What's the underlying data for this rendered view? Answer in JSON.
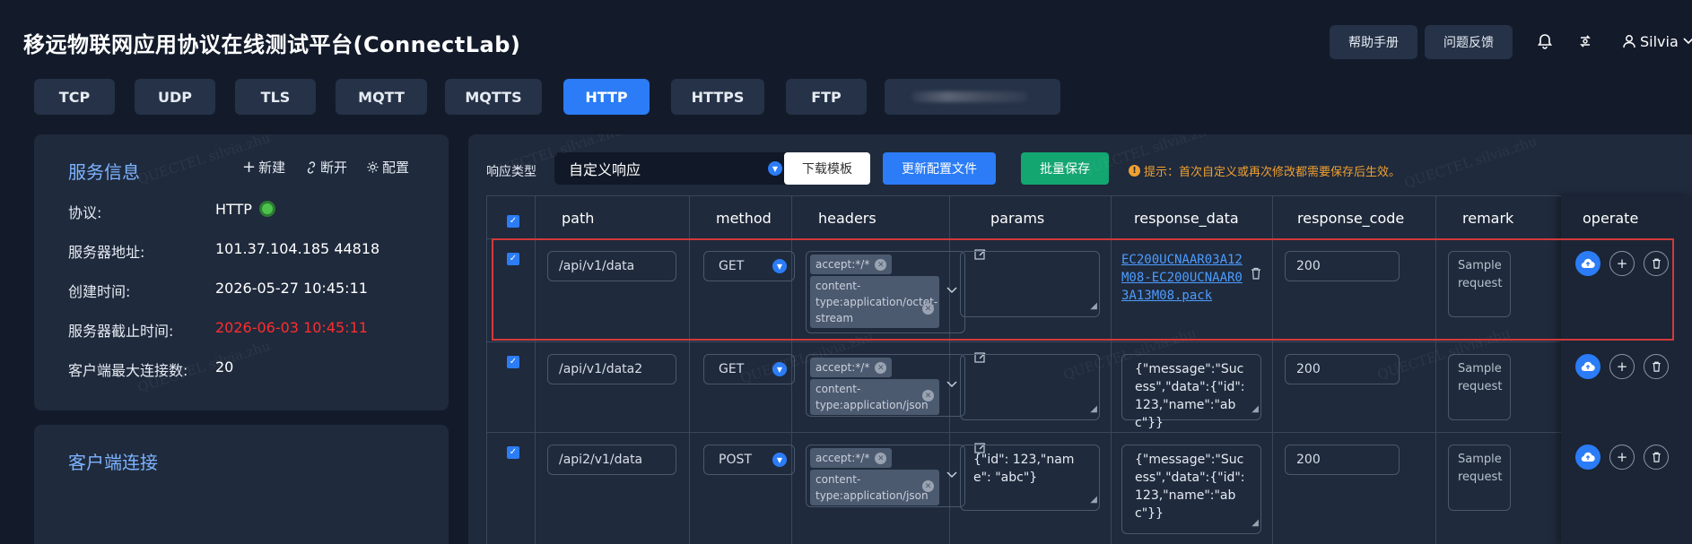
{
  "header": {
    "title": "移远物联网应用协议在线测试平台(ConnectLab)",
    "help_button": "帮助手册",
    "feedback_button": "问题反馈",
    "user_name": "Silvia"
  },
  "protocol_tabs": [
    "TCP",
    "UDP",
    "TLS",
    "MQTT",
    "MQTTS",
    "HTTP",
    "HTTPS",
    "FTP"
  ],
  "active_tab": "HTTP",
  "service_info": {
    "title": "服务信息",
    "actions": {
      "new": "新建",
      "disconnect": "断开",
      "config": "配置"
    },
    "rows": [
      {
        "label": "协议:",
        "value": "HTTP"
      },
      {
        "label": "服务器地址:",
        "value": "101.37.104.185 44818"
      },
      {
        "label": "创建时间:",
        "value": "2026-05-27 10:45:11"
      },
      {
        "label": "服务器截止时间:",
        "value": "2026-06-03 10:45:11"
      },
      {
        "label": "客户端最大连接数:",
        "value": "20"
      }
    ]
  },
  "client_panel": {
    "title": "客户端连接"
  },
  "toolbar": {
    "response_type_label": "响应类型",
    "response_type_value": "自定义响应",
    "download_template": "下载模板",
    "update_config": "更新配置文件",
    "batch_save": "批量保存",
    "tip": "提示：首次自定义或再次修改都需要保存后生效。"
  },
  "table": {
    "columns": [
      "path",
      "method",
      "headers",
      "params",
      "response_data",
      "response_code",
      "remark",
      "operate"
    ],
    "rows": [
      {
        "path": "/api/v1/data",
        "method": "GET",
        "headers": [
          "accept:*/*",
          "content-type:application/octet-stream"
        ],
        "params": "",
        "response_data": "EC200UCNAAR03A12M08-EC200UCNAAR03A13M08.pack",
        "response_code": "200",
        "remark": "Sample request"
      },
      {
        "path": "/api/v1/data2",
        "method": "GET",
        "headers": [
          "accept:*/*",
          "content-type:application/json"
        ],
        "params": "",
        "response_data": "{\"message\":\"Sucess\",\"data\":{\"id\":123,\"name\":\"abc\"}}",
        "response_code": "200",
        "remark": "Sample request"
      },
      {
        "path": "/api2/v1/data",
        "method": "POST",
        "headers": [
          "accept:*/*",
          "content-type:application/json"
        ],
        "params": "{\"id\": 123,\"name\": \"abc\"}",
        "response_data": "{\"message\":\"Sucess\",\"data\":{\"id\":123,\"name\":\"abc\"}}",
        "response_code": "200",
        "remark": "Sample request"
      }
    ]
  },
  "watermark": "QUECTEL silvia.zhu",
  "colors": {
    "accent": "#2b7cf6",
    "success": "#13a671",
    "danger": "#ff2d2d",
    "warning": "#f0a030"
  }
}
